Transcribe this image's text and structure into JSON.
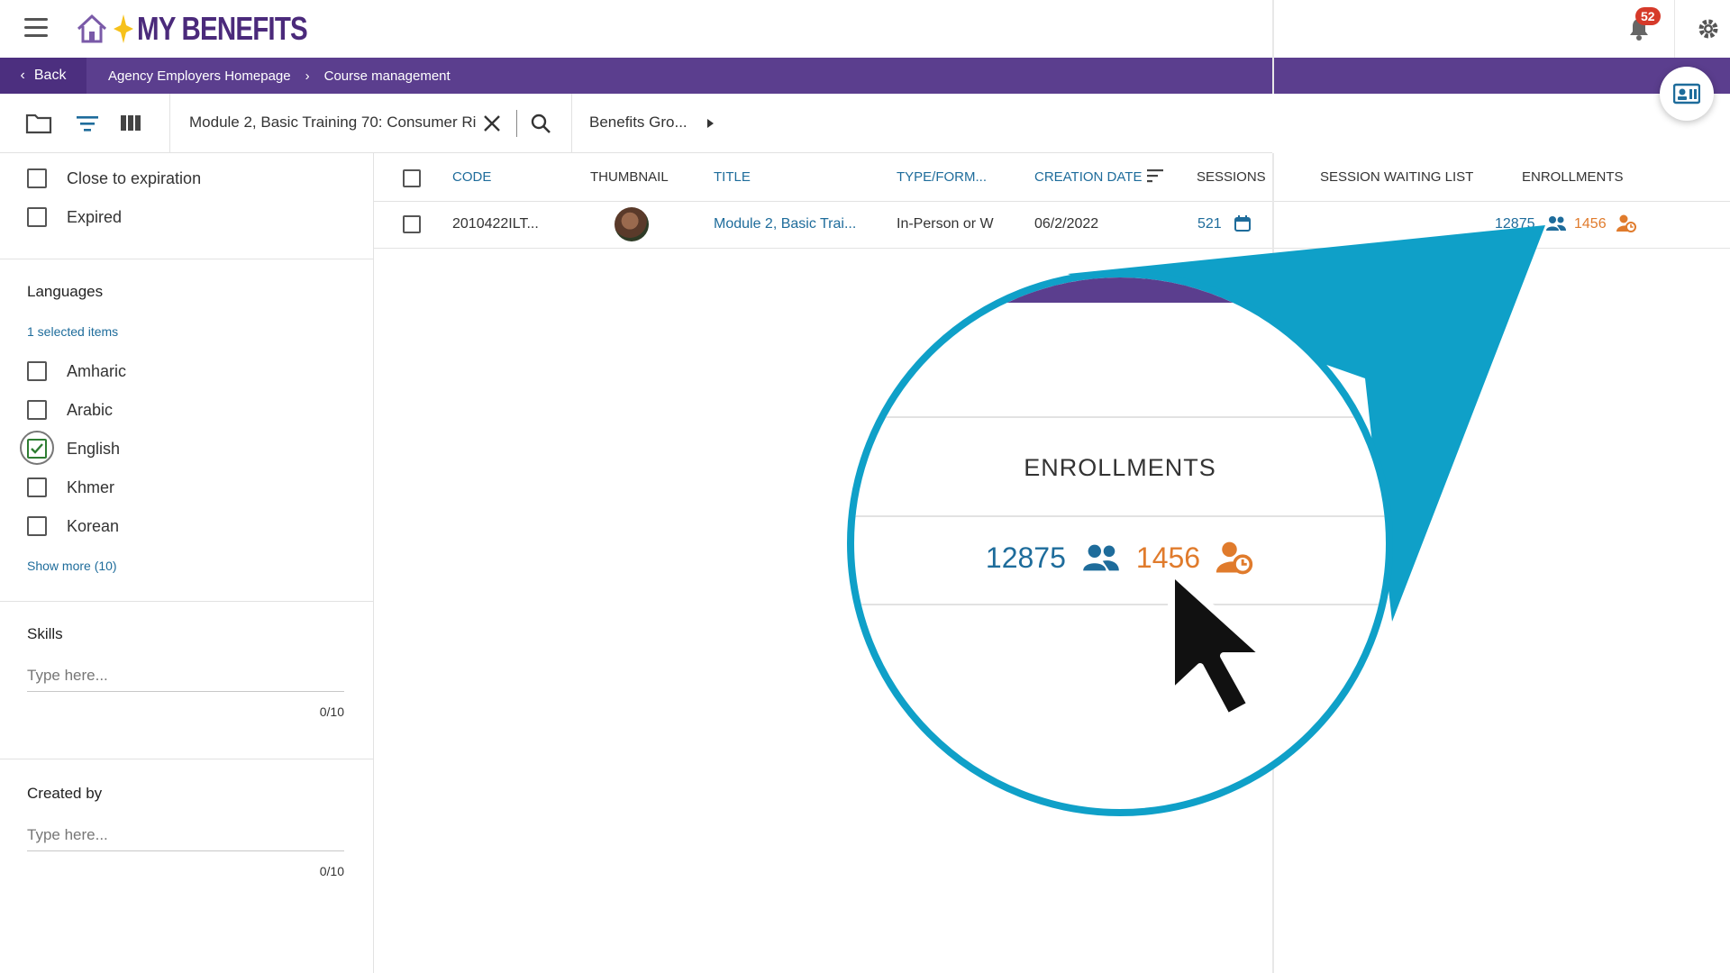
{
  "app": {
    "logo_text": "MY BENEFITS",
    "notification_count": "52"
  },
  "breadcrumb": {
    "back_label": "Back",
    "items": [
      "Agency Employers Homepage",
      "Course management"
    ]
  },
  "toolbar": {
    "search_value": "Module 2, Basic Training 70: Consumer Ri",
    "filter_label": "Benefits Gro..."
  },
  "sidebar": {
    "status_options": [
      {
        "label": "Close to expiration",
        "checked": false
      },
      {
        "label": "Expired",
        "checked": false
      }
    ],
    "languages": {
      "title": "Languages",
      "selected_text": "1 selected items",
      "options": [
        {
          "label": "Amharic",
          "checked": false
        },
        {
          "label": "Arabic",
          "checked": false
        },
        {
          "label": "English",
          "checked": true
        },
        {
          "label": "Khmer",
          "checked": false
        },
        {
          "label": "Korean",
          "checked": false
        }
      ],
      "show_more": "Show more (10)"
    },
    "skills": {
      "title": "Skills",
      "placeholder": "Type here...",
      "counter": "0/10"
    },
    "created_by": {
      "title": "Created by",
      "placeholder": "Type here...",
      "counter": "0/10"
    }
  },
  "table": {
    "headers": [
      "CODE",
      "THUMBNAIL",
      "TITLE",
      "TYPE/FORM...",
      "CREATION DATE",
      "SESSIONS",
      "SESSION WAITING LIST",
      "ENROLLMENTS"
    ],
    "row": {
      "code": "2010422ILT...",
      "title": "Module 2, Basic Trai...",
      "type": "In-Person or W",
      "creation_date": "06/2/2022",
      "sessions": "521",
      "enrollments": "12875",
      "waiting": "1456"
    }
  },
  "magnified": {
    "header": "ENROLLMENTS",
    "enrollments": "12875",
    "waiting": "1456"
  },
  "colors": {
    "purple": "#5b3e8e",
    "link_blue": "#1e6c9b",
    "orange": "#e07b2c",
    "callout_cyan": "#0fa0c8"
  }
}
